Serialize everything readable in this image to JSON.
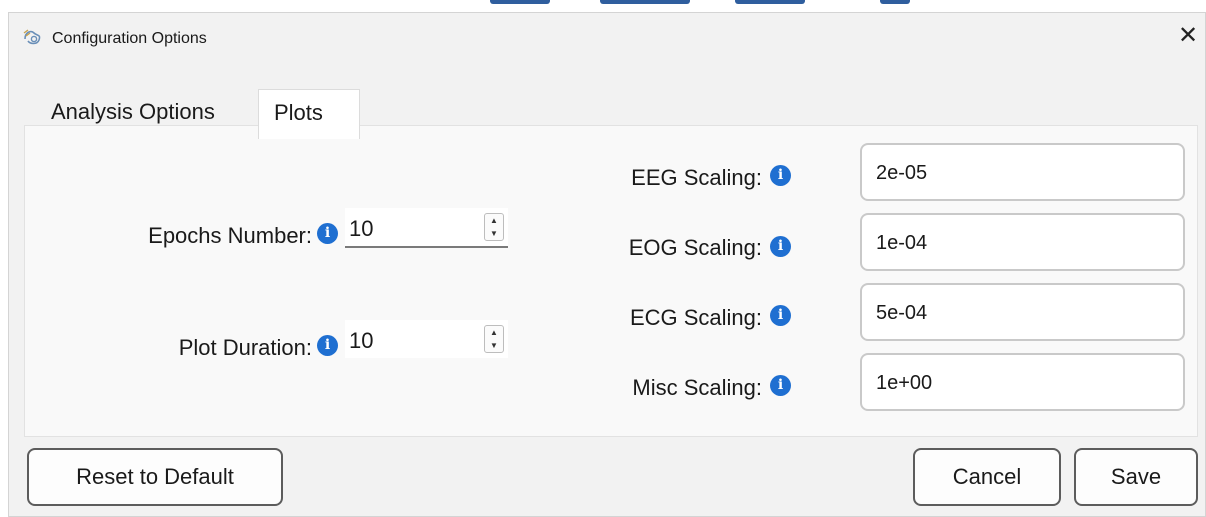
{
  "window": {
    "title": "Configuration Options",
    "close_glyph": "✕",
    "app_icon": "app-logo-icon"
  },
  "tabs": [
    {
      "label": "Analysis Options",
      "active": false
    },
    {
      "label": "Plots",
      "active": true
    }
  ],
  "plots": {
    "epochs_number": {
      "label": "Epochs Number:",
      "value": "10"
    },
    "plot_duration": {
      "label": "Plot Duration:",
      "value": "10"
    },
    "eeg_scaling": {
      "label": "EEG Scaling:",
      "value": "2e-05"
    },
    "eog_scaling": {
      "label": "EOG Scaling:",
      "value": "1e-04"
    },
    "ecg_scaling": {
      "label": "ECG Scaling:",
      "value": "5e-04"
    },
    "misc_scaling": {
      "label": "Misc Scaling:",
      "value": "1e+00"
    }
  },
  "info_glyph": "i",
  "spin_up_glyph": "▲",
  "spin_down_glyph": "▼",
  "buttons": {
    "reset": "Reset to Default",
    "cancel": "Cancel",
    "save": "Save"
  },
  "colors": {
    "info_icon": "#1f6fd1",
    "window_bg": "#f2f2f2",
    "accent_strip": "#2f5e9e"
  }
}
